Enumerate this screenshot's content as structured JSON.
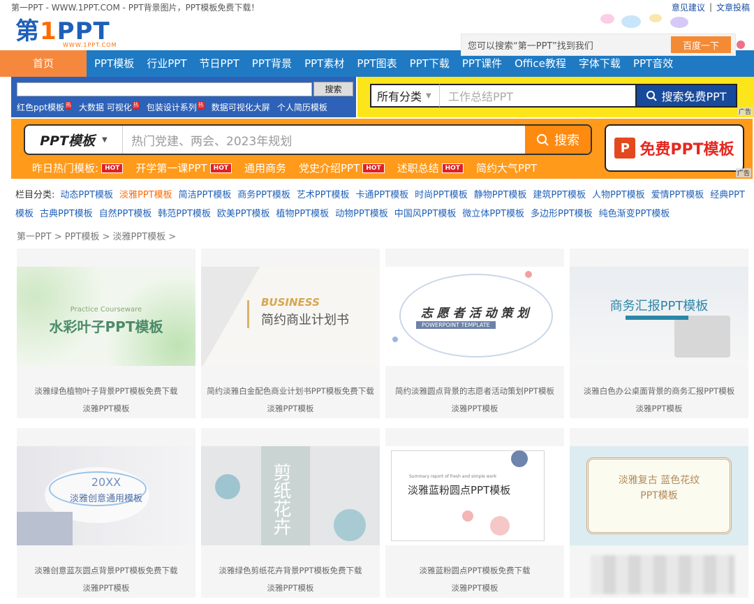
{
  "topbar": {
    "title": "第一PPT - WWW.1PPT.COM - PPT背景图片，PPT模板免费下载！",
    "feedback": "意见建议",
    "sep": "|",
    "submit": "文章投稿"
  },
  "logo": {
    "text_a": "第",
    "text_one": "1",
    "text_b": "PPT",
    "sub": "WWW.1PPT.COM"
  },
  "header_search": {
    "placeholder": "您可以搜索“第一PPT”找到我们",
    "button": "百度一下"
  },
  "nav": [
    "首页",
    "PPT模板",
    "行业PPT",
    "节日PPT",
    "PPT背景",
    "PPT素材",
    "PPT图表",
    "PPT下载",
    "PPT课件",
    "Office教程",
    "字体下载",
    "PPT音效"
  ],
  "blue_search": {
    "button": "搜索",
    "hot": [
      "红色ppt模板",
      "大数据 可视化",
      "包装设计系列",
      "数据可视化大屏",
      "个人简历模板"
    ]
  },
  "yellow_search": {
    "category": "所有分类",
    "keyword": "工作总结PPT",
    "button": "搜索免费PPT",
    "ad": "广告"
  },
  "orange": {
    "category": "PPT模板",
    "keyword": "热门党建、两会、2023年规划",
    "button": "搜索",
    "free": "免费PPT模板",
    "pp": "P",
    "ad": "广告",
    "hot_label": "昨日热门模板:",
    "hot_badge": "HOT",
    "hot": [
      "开学第一课PPT",
      "通用商务",
      "党史介绍PPT",
      "述职总结",
      "简约大气PPT"
    ]
  },
  "categories": {
    "label": "栏目分类:",
    "items": [
      "动态PPT模板",
      "淡雅PPT模板",
      "简洁PPT模板",
      "商务PPT模板",
      "艺术PPT模板",
      "卡通PPT模板",
      "时尚PPT模板",
      "静物PPT模板",
      "建筑PPT模板",
      "人物PPT模板",
      "爱情PPT模板",
      "经典PPT模板",
      "古典PPT模板",
      "自然PPT模板",
      "韩范PPT模板",
      "欧美PPT模板",
      "植物PPT模板",
      "动物PPT模板",
      "中国风PPT模板",
      "微立体PPT模板",
      "多边形PPT模板",
      "纯色渐变PPT模板"
    ],
    "active": "淡雅PPT模板"
  },
  "breadcrumb": "第一PPT > PPT模板 > 淡雅PPT模板 >",
  "cards": [
    {
      "title": "淡雅绿色植物叶子背景PPT模板免费下载",
      "category": "淡雅PPT模板",
      "thumb_en": "Practice Courseware",
      "thumb_cn": "水彩叶子PPT模板"
    },
    {
      "title": "简约淡雅白金配色商业计划书PPT模板免费下载",
      "category": "淡雅PPT模板",
      "thumb_en": "BUSINESS",
      "thumb_cn": "简约商业计划书"
    },
    {
      "title": "简约淡雅圆点背景的志愿者活动策划PPT模板",
      "category": "淡雅PPT模板",
      "thumb_en": "POWERPOINT TEMPLATE",
      "thumb_cn": "志 愿 者 活 动 策 划"
    },
    {
      "title": "淡雅白色办公桌面背景的商务汇报PPT模板",
      "category": "淡雅PPT模板",
      "thumb_en": "",
      "thumb_cn": "商务汇报PPT模板"
    },
    {
      "title": "淡雅创意蓝灰圆点背景PPT模板免费下载",
      "category": "淡雅PPT模板",
      "thumb_en": "20XX",
      "thumb_cn": "淡雅创意通用模板"
    },
    {
      "title": "淡雅绿色剪纸花卉背景PPT模板免费下载",
      "category": "淡雅PPT模板",
      "thumb_en": "",
      "thumb_cn": "剪纸花卉"
    },
    {
      "title": "淡雅蓝粉圆点PPT模板免费下载",
      "category": "淡雅PPT模板",
      "thumb_en": "Summary report of fresh and simple work",
      "thumb_cn": "淡雅蓝粉圆点PPT模板"
    },
    {
      "title": "",
      "category": "",
      "thumb_en": "",
      "thumb_cn": "淡雅复古 蓝色花纹PPT模板"
    }
  ]
}
